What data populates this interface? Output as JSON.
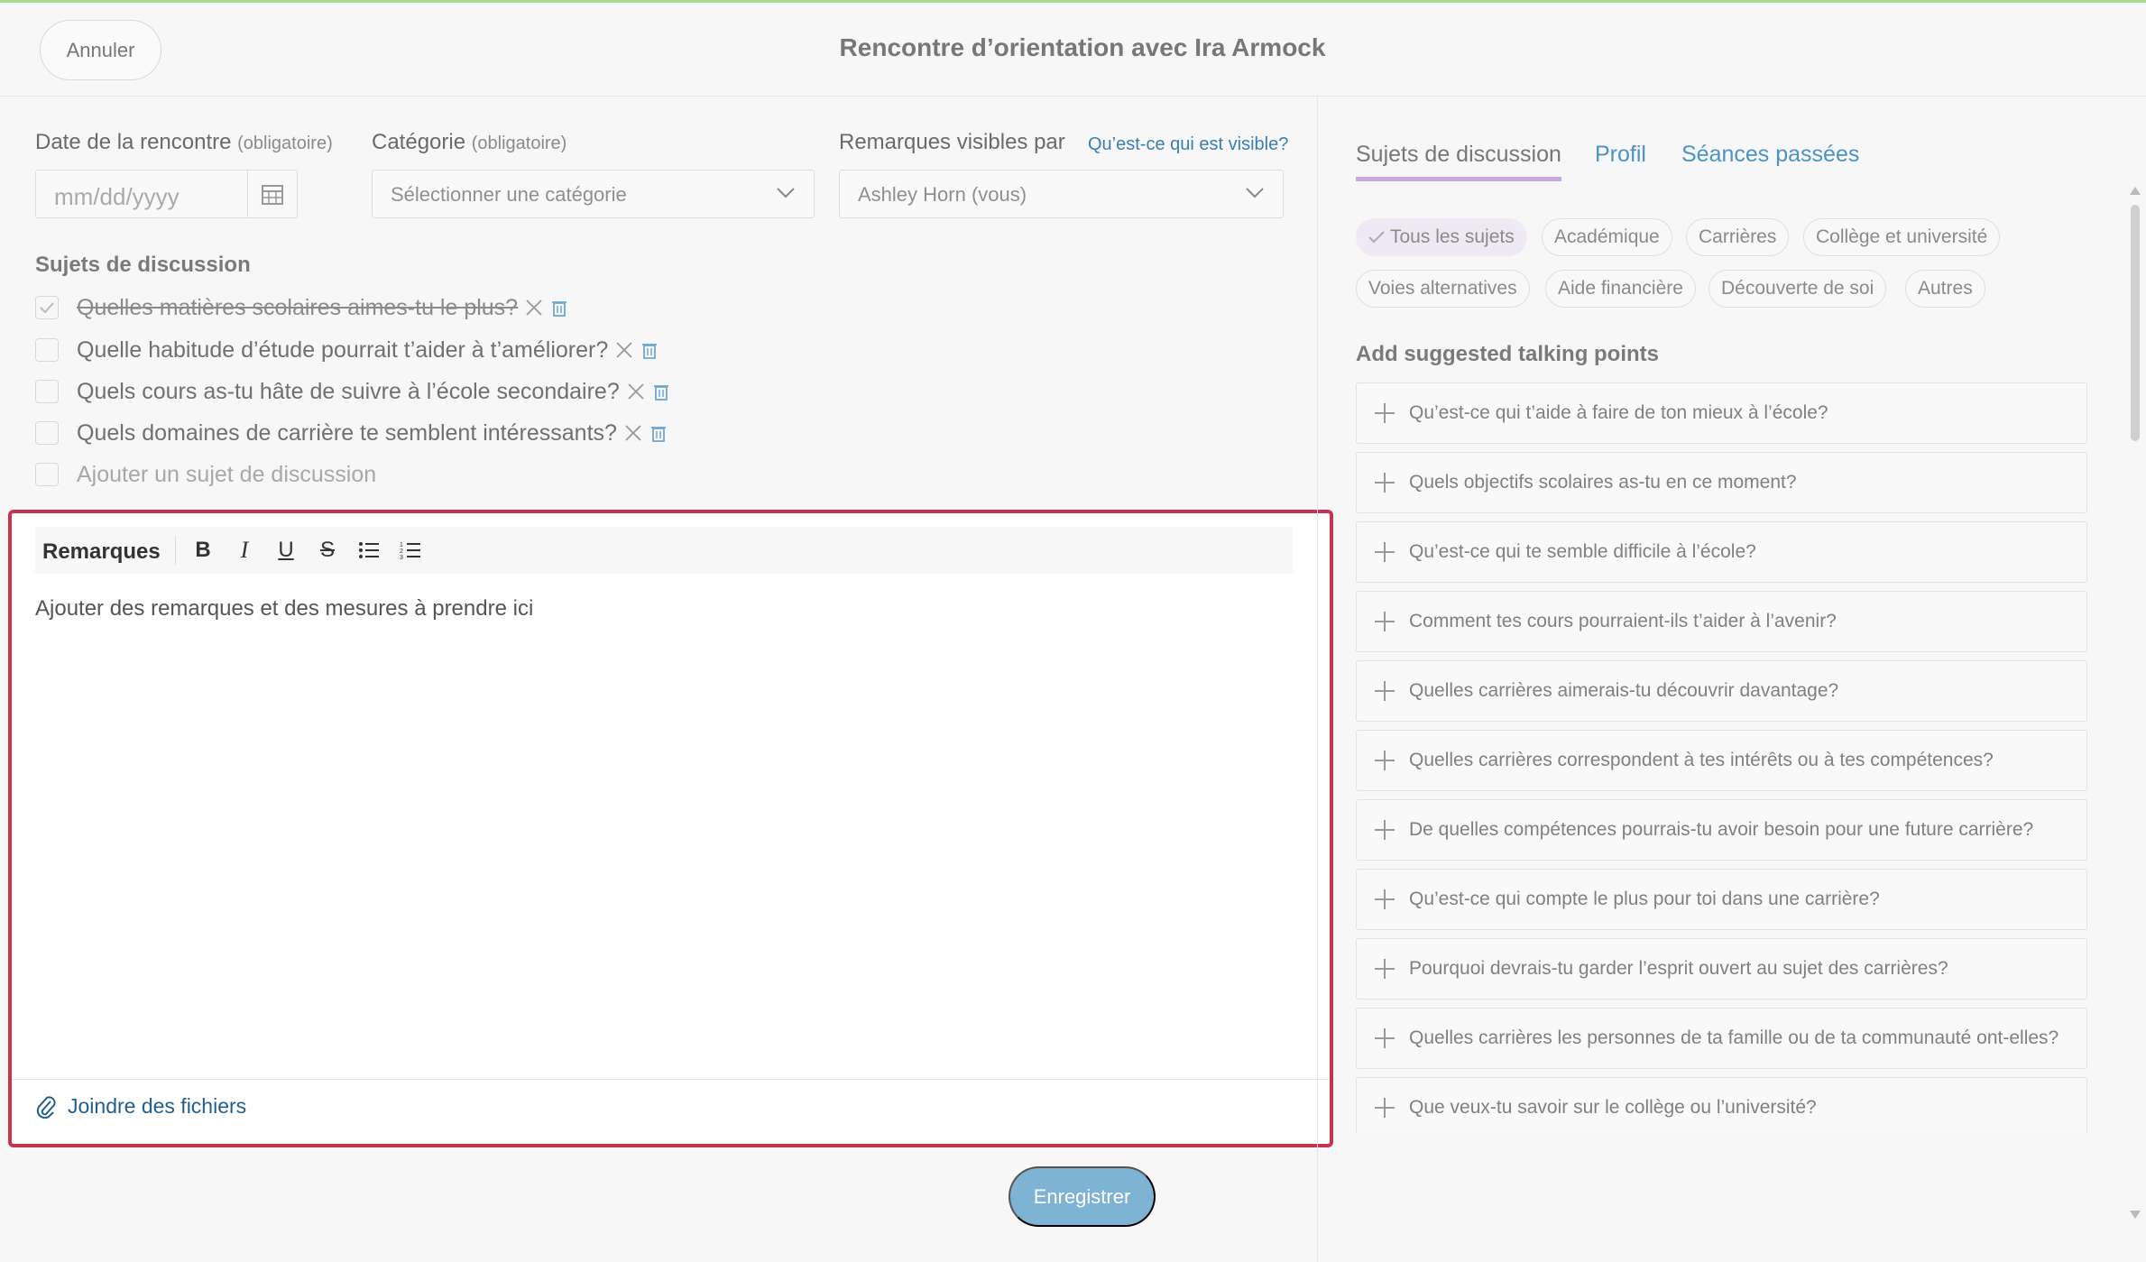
{
  "header": {
    "cancel_label": "Annuler",
    "title": "Rencontre d’orientation avec Ira Armock"
  },
  "form": {
    "date_label": "Date de la rencontre",
    "date_req": "(obligatoire)",
    "date_placeholder": "mm/dd/yyyy",
    "category_label": "Catégorie",
    "category_req": "(obligatoire)",
    "category_value": "Sélectionner une catégorie",
    "visible_label": "Remarques visibles par",
    "visible_link": "Qu’est-ce qui est visible?",
    "visible_value": "Ashley Horn (vous)"
  },
  "topics": {
    "title": "Sujets de discussion",
    "items": [
      {
        "label": "Quelles matières scolaires aimes-tu le plus?",
        "checked": true
      },
      {
        "label": "Quelle habitude d’étude pourrait t’aider à t’améliorer?",
        "checked": false
      },
      {
        "label": "Quels cours as-tu hâte de suivre à l’école secondaire?",
        "checked": false
      },
      {
        "label": "Quels domaines de carrière te semblent intéressants?",
        "checked": false
      }
    ],
    "add_placeholder": "Ajouter un sujet de discussion"
  },
  "editor": {
    "toolbar_label": "Remarques",
    "bold": "B",
    "italic": "I",
    "underline": "U",
    "strike": "S",
    "placeholder": "Ajouter des remarques et des mesures à prendre ici",
    "attach_label": "Joindre des fichiers"
  },
  "save_label": "Enregistrer",
  "right": {
    "tabs": [
      "Sujets de discussion",
      "Profil",
      "Séances passées"
    ],
    "active_tab": 0,
    "chips": [
      "Tous les sujets",
      "Académique",
      "Carrières",
      "Collège et université",
      "Voies alternatives",
      "Aide financière",
      "Découverte de soi",
      "Autres"
    ],
    "suggested_title": "Add suggested talking points",
    "suggestions": [
      "Qu’est-ce qui t’aide à faire de ton mieux à l’école?",
      "Quels objectifs scolaires as-tu en ce moment?",
      "Qu’est-ce qui te semble difficile à l’école?",
      "Comment tes cours pourraient-ils t’aider à l’avenir?",
      "Quelles carrières aimerais-tu découvrir davantage?",
      "Quelles carrières correspondent à tes intérêts ou à tes compétences?",
      "De quelles compétences pourrais-tu avoir besoin pour une future carrière?",
      "Qu’est-ce qui compte le plus pour toi dans une carrière?",
      "Pourquoi devrais-tu garder l’esprit ouvert au sujet des carrières?",
      "Quelles carrières les personnes de ta famille ou de ta communauté ont-elles?",
      "Que veux-tu savoir sur le collège ou l’université?"
    ]
  },
  "colors": {
    "highlight_border": "#c8334f",
    "link": "#3a7fb2",
    "save_button": "#7fb3d3",
    "active_tab_underline": "#c7a9de"
  }
}
